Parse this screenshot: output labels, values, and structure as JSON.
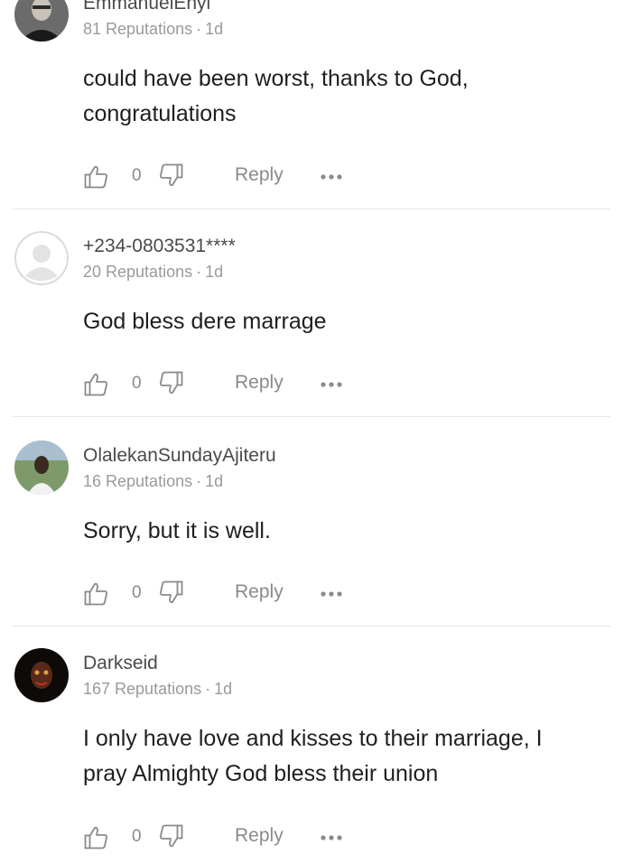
{
  "comments": [
    {
      "username": "EmmanuelEnyi",
      "reputations": "81 Reputations",
      "time": "1d",
      "text_lines": [
        "could have been worst, thanks to God,",
        "congratulations"
      ],
      "likes": "0",
      "reply_label": "Reply",
      "avatar": "photo-avatar"
    },
    {
      "username": "+234-0803531****",
      "reputations": "20 Reputations",
      "time": "1d",
      "text_lines": [
        "God bless dere marrage"
      ],
      "likes": "0",
      "reply_label": "Reply",
      "avatar": "default-avatar"
    },
    {
      "username": "OlalekanSundayAjiteru",
      "reputations": "16 Reputations",
      "time": "1d",
      "text_lines": [
        "Sorry, but it is well."
      ],
      "likes": "0",
      "reply_label": "Reply",
      "avatar": "photo-avatar"
    },
    {
      "username": "Darkseid",
      "reputations": "167 Reputations",
      "time": "1d",
      "text_lines": [
        "I only have love and kisses to their marriage, I",
        "pray Almighty God bless their union"
      ],
      "likes": "0",
      "reply_label": "Reply",
      "avatar": "photo-avatar"
    }
  ],
  "meta_separator": "·",
  "colors": {
    "text": "#1f1f1f",
    "username": "#4a4a4a",
    "meta": "#9a9a9a",
    "icon": "#8a8a8a",
    "divider": "#e6e6e6"
  }
}
